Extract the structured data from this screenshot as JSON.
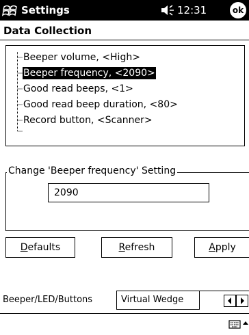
{
  "titlebar": {
    "app_title": "Settings",
    "time": "12:31",
    "ok_label": "ok"
  },
  "page": {
    "title": "Data Collection"
  },
  "tree": {
    "items": [
      {
        "label": "Beeper volume, <High>"
      },
      {
        "label": "Beeper frequency, <2090>",
        "selected": true
      },
      {
        "label": "Good read beeps, <1>"
      },
      {
        "label": "Good read beep duration, <80>"
      },
      {
        "label": "Record button, <Scanner>"
      }
    ]
  },
  "setting": {
    "group_label": "Change 'Beeper frequency' Setting",
    "value": "2090"
  },
  "buttons": {
    "defaults": {
      "mnemonic": "D",
      "rest": "efaults"
    },
    "refresh": {
      "mnemonic": "R",
      "rest": "efresh"
    },
    "apply": {
      "mnemonic": "A",
      "rest": "pply"
    }
  },
  "tabs": [
    {
      "label": "Beeper/LED/Buttons",
      "active": true
    },
    {
      "label": "Virtual Wedge",
      "active": false
    }
  ],
  "icons": [
    "windows-start-icon",
    "speaker-volume-icon",
    "scroll-left-icon",
    "scroll-right-icon",
    "keyboard-icon",
    "chevron-up-icon"
  ]
}
